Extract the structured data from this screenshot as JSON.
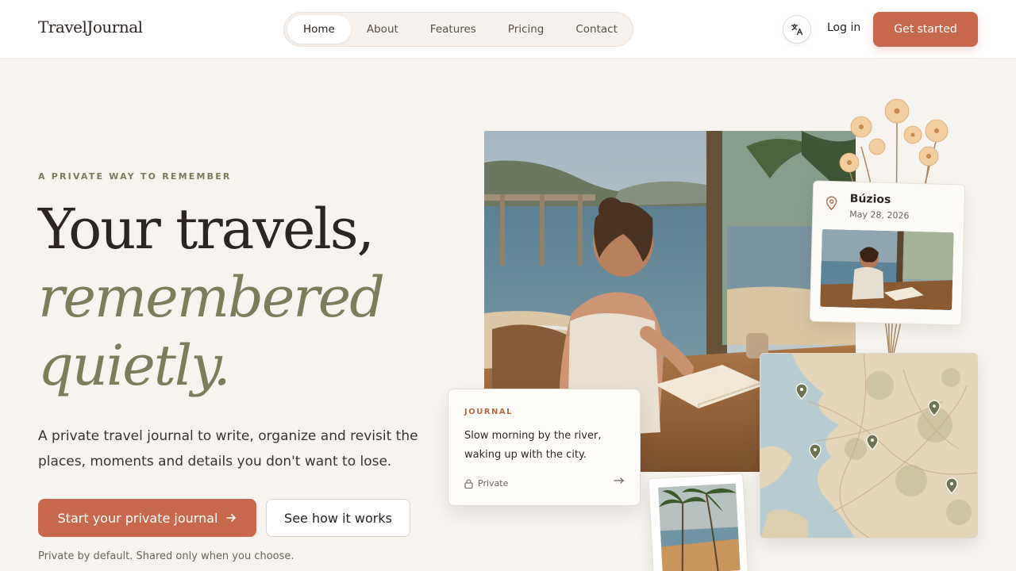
{
  "header": {
    "logo": "TravelJournal",
    "nav": [
      {
        "label": "Home",
        "active": true
      },
      {
        "label": "About",
        "active": false
      },
      {
        "label": "Features",
        "active": false
      },
      {
        "label": "Pricing",
        "active": false
      },
      {
        "label": "Contact",
        "active": false
      }
    ],
    "language_icon": "translate-icon",
    "login_label": "Log in",
    "cta_label": "Get started"
  },
  "hero": {
    "eyebrow": "A PRIVATE WAY TO REMEMBER",
    "title_line1": "Your travels,",
    "title_line2": "remembered",
    "title_line3": "quietly.",
    "lead": "A private travel journal to write, organize and revisit the places, moments and details you don't want to lose.",
    "primary_cta": "Start your private journal",
    "secondary_cta": "See how it works",
    "footnote": "Private by default. Shared only when you choose."
  },
  "place_card": {
    "title": "Búzios",
    "date": "May 28, 2026"
  },
  "journal_card": {
    "label": "JOURNAL",
    "text": "Slow morning by the river, waking up with the city.",
    "visibility": "Private"
  },
  "colors": {
    "accent": "#c8684c",
    "olive": "#7a7e5d",
    "background": "#f7f4ef"
  }
}
